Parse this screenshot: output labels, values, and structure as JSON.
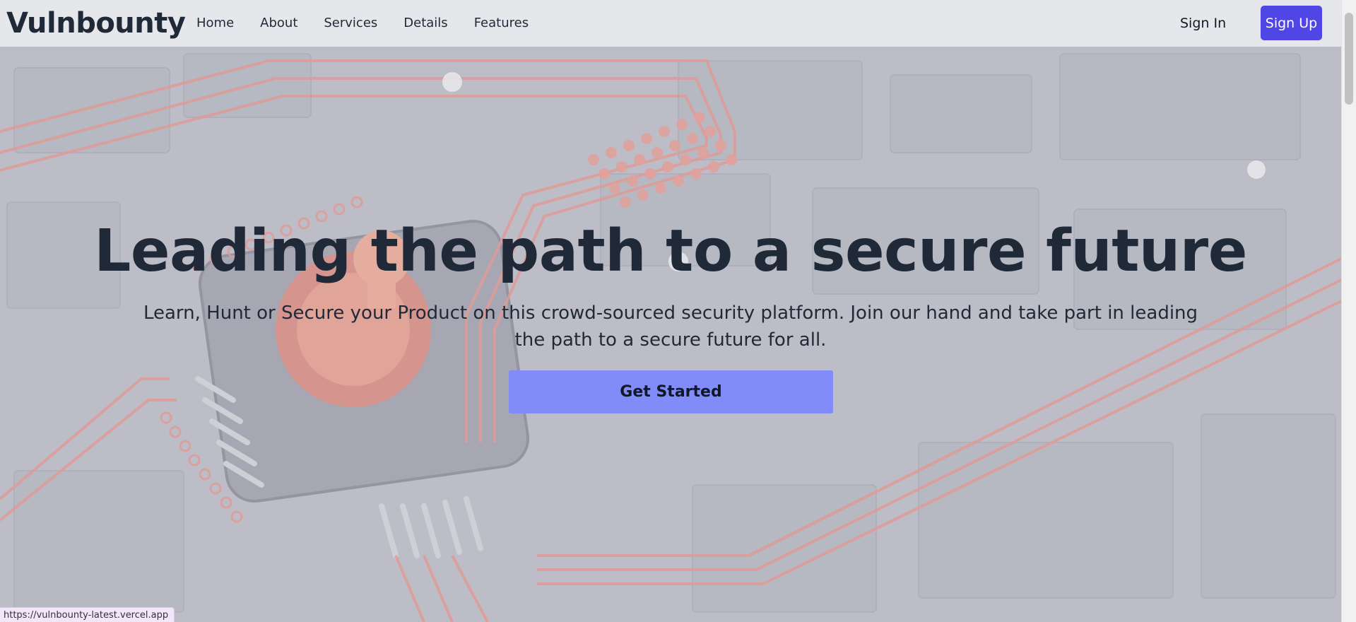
{
  "nav": {
    "logo": "Vulnbounty",
    "links": [
      "Home",
      "About",
      "Services",
      "Details",
      "Features"
    ],
    "sign_in": "Sign In",
    "sign_up": "Sign Up"
  },
  "hero": {
    "title": "Leading the path to a secure future",
    "subtitle": "Learn, Hunt or Secure your Product on this crowd-sourced security platform. Join our hand and take part in leading the path to a secure future for all.",
    "cta": "Get Started"
  },
  "status_url": "https://vulnbounty-latest.vercel.app",
  "colors": {
    "accent": "#4f46e5",
    "cta": "#818cf8",
    "circuit": "#e86a5a",
    "text": "#1f2937"
  }
}
